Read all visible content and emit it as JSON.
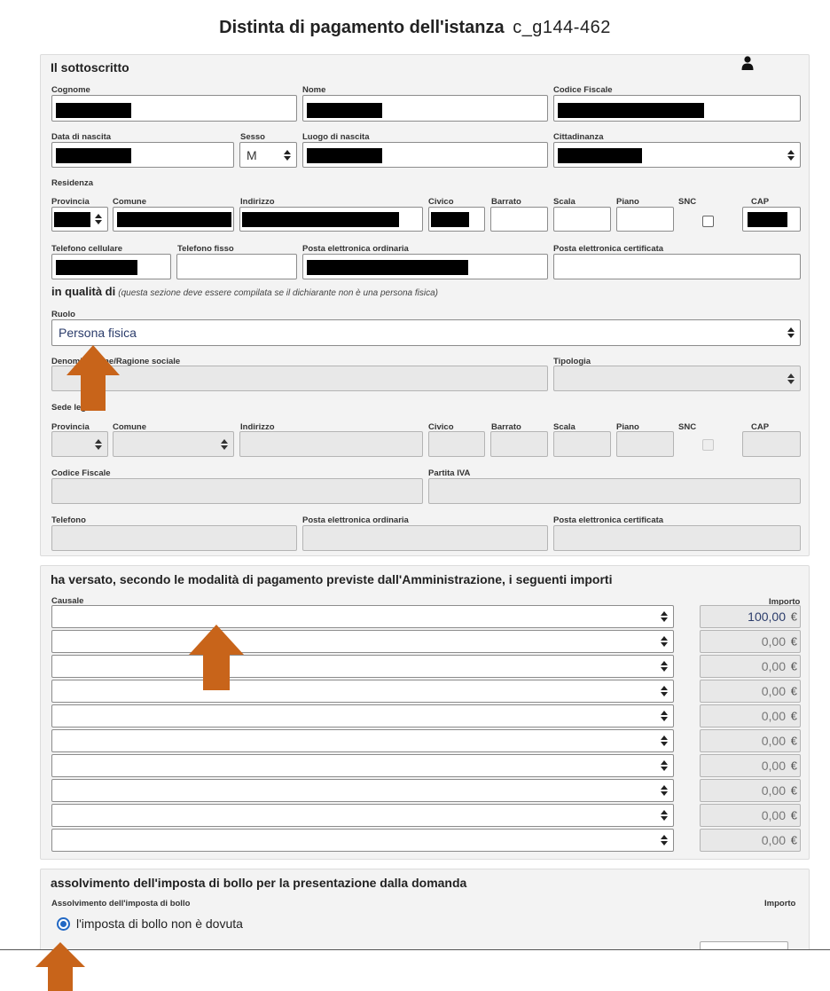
{
  "header": {
    "title": "Distinta di pagamento dell'istanza",
    "code": "c_g144-462"
  },
  "sottoscritto": {
    "title": "Il sottoscritto",
    "labels": {
      "cognome": "Cognome",
      "nome": "Nome",
      "codice_fiscale": "Codice Fiscale",
      "data_nascita": "Data di nascita",
      "sesso": "Sesso",
      "luogo_nascita": "Luogo di nascita",
      "cittadinanza": "Cittadinanza",
      "residenza": "Residenza",
      "provincia": "Provincia",
      "comune": "Comune",
      "indirizzo": "Indirizzo",
      "civico": "Civico",
      "barrato": "Barrato",
      "scala": "Scala",
      "piano": "Piano",
      "snc": "SNC",
      "cap": "CAP",
      "telefono_cellulare": "Telefono cellulare",
      "telefono_fisso": "Telefono fisso",
      "pec_ordinaria": "Posta elettronica ordinaria",
      "pec_certificata": "Posta elettronica certificata"
    },
    "sesso_value": "M",
    "icon": "person-icon"
  },
  "qualita": {
    "heading": "in qualità di",
    "note": "(questa sezione deve essere compilata se il dichiarante non è una persona fisica)",
    "labels": {
      "ruolo": "Ruolo",
      "denominazione": "Denominazione/Ragione sociale",
      "tipologia": "Tipologia",
      "sede_legale": "Sede legale",
      "provincia": "Provincia",
      "comune": "Comune",
      "indirizzo": "Indirizzo",
      "civico": "Civico",
      "barrato": "Barrato",
      "scala": "Scala",
      "piano": "Piano",
      "snc": "SNC",
      "cap": "CAP",
      "codice_fiscale": "Codice Fiscale",
      "partita_iva": "Partita IVA",
      "telefono": "Telefono",
      "pec_ordinaria": "Posta elettronica ordinaria",
      "pec_certificata": "Posta elettronica certificata"
    },
    "ruolo_value": "Persona fisica"
  },
  "versato": {
    "title": "ha versato, secondo le modalità di pagamento previste dall'Amministrazione, i seguenti importi",
    "causale_label": "Causale",
    "importo_label": "Importo",
    "currency": "€",
    "amounts": [
      "100,00",
      "0,00",
      "0,00",
      "0,00",
      "0,00",
      "0,00",
      "0,00",
      "0,00",
      "0,00",
      "0,00"
    ]
  },
  "bollo": {
    "title": "assolvimento dell'imposta di bollo per la presentazione dalla domanda",
    "label": "Assolvimento dell'imposta di bollo",
    "importo_label": "Importo",
    "option_selected": "l'imposta di bollo non è dovuta"
  },
  "colors": {
    "arrow": "#c8641a",
    "accent_text": "#2b3c6b",
    "radio": "#2268c4"
  }
}
